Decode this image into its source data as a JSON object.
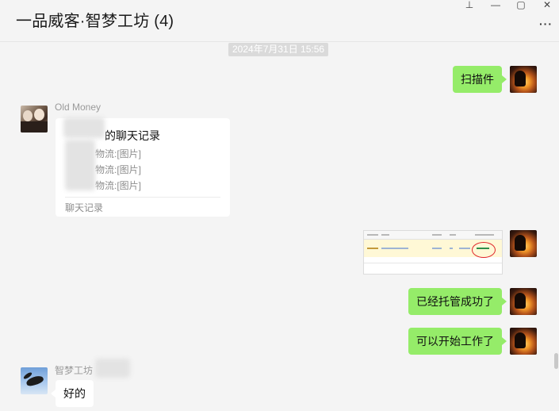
{
  "header": {
    "chat_title": "一品威客·智梦工坊 (4)",
    "controls": {
      "pin_icon": "⊥",
      "minimize_icon": "—",
      "maximize_icon": "▢",
      "close_icon": "✕"
    },
    "more_label": "···"
  },
  "timestamp": "2024年7月31日 15:56",
  "messages": [
    {
      "from": "self",
      "text": "扫描件"
    },
    {
      "from": "Old Money",
      "type": "chat_record",
      "title": "的聊天记录",
      "lines": [
        "物流:[图片]",
        "物流:[图片]",
        "物流:[图片]"
      ],
      "footer": "聊天记录"
    },
    {
      "from": "self",
      "type": "image"
    },
    {
      "from": "self",
      "text": "已经托管成功了"
    },
    {
      "from": "self",
      "text": "可以开始工作了"
    },
    {
      "from": "智梦工坊",
      "text": "好的"
    }
  ],
  "senders": {
    "old_money": "Old Money",
    "zhimeng": "智梦工坊"
  },
  "colors": {
    "self_bubble": "#95ec69",
    "other_bubble": "#ffffff",
    "background": "#f4f4f4",
    "annotation_circle": "#e0252a"
  }
}
